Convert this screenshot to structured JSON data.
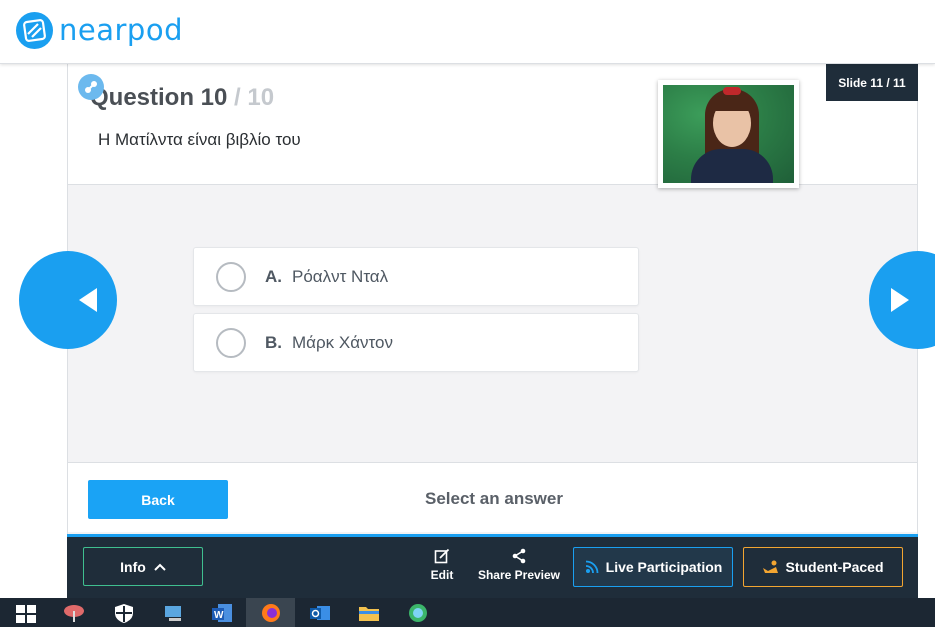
{
  "app": {
    "logo_text": "nearpod"
  },
  "question": {
    "title_prefix": "Question 10",
    "title_total": " / 10",
    "text": "Η Ματίλντα είναι βιβλίο του"
  },
  "slide_counter": "Slide 11 / 11",
  "answers": [
    {
      "letter": "A.",
      "text": "Ρόαλντ Νταλ"
    },
    {
      "letter": "B.",
      "text": "Μάρκ Χάντον"
    }
  ],
  "footer": {
    "back_label": "Back",
    "select_label": "Select an answer"
  },
  "toolbar": {
    "info_label": "Info",
    "edit_label": "Edit",
    "share_label": "Share Preview",
    "live_label": "Live Participation",
    "paced_label": "Student-Paced"
  },
  "colors": {
    "brand": "#1a9ff0",
    "toolbar_bg": "#1f2d3a",
    "info_border": "#3fbf8f",
    "paced_border": "#f3a531"
  },
  "taskbar": {
    "icons": [
      "windows-start-icon",
      "app-icon",
      "security-shield-icon",
      "computer-icon",
      "word-icon",
      "firefox-icon",
      "outlook-icon",
      "file-explorer-icon",
      "browser-icon"
    ]
  }
}
